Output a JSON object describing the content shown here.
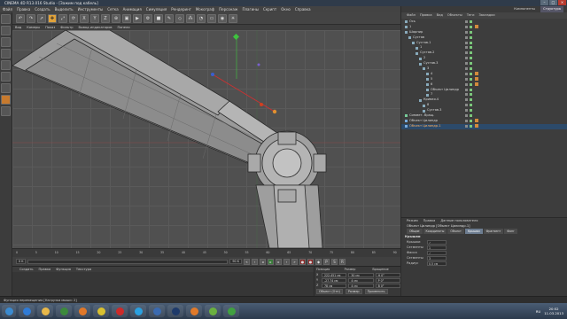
{
  "window": {
    "title": "CINEMA 4D R13.016 Studio - [Зажим под кабель]"
  },
  "menubar": [
    "Файл",
    "Правка",
    "Создать",
    "Выделить",
    "Инструменты",
    "Сетка",
    "Анимация",
    "Симуляция",
    "Рендеринг",
    "Мокограф",
    "Персонаж",
    "Плагины",
    "Скрипт",
    "Окно",
    "Справка"
  ],
  "toolbar": {
    "buttons": [
      "undo",
      "redo",
      "select",
      "move",
      "scale",
      "rotate",
      "x",
      "y",
      "z",
      "coord",
      "render-region",
      "render",
      "render-settings",
      "cube",
      "pen",
      "subdivide",
      "array",
      "deformer",
      "floor",
      "camera",
      "light"
    ]
  },
  "viewport": {
    "menu": [
      "Вид",
      "Камеры",
      "Показ",
      "Фильтр",
      "Вывод индикаторов",
      "Панели"
    ]
  },
  "timeline": {
    "ticks": [
      "0",
      "5",
      "10",
      "15",
      "20",
      "25",
      "30",
      "35",
      "40",
      "45",
      "50",
      "55",
      "60",
      "65",
      "70",
      "75",
      "80",
      "85",
      "90"
    ],
    "start_field": "0 K",
    "end_field": "90 K",
    "cur_field": "0 K"
  },
  "materials": {
    "menu": [
      "Создать",
      "Правка",
      "Функция",
      "Текстура"
    ]
  },
  "coords": {
    "headers": [
      "Позиция",
      "Размер",
      "Вращение"
    ],
    "rows": [
      {
        "axis": "X",
        "pos": "222.451 см",
        "size": "30 см",
        "rot": "H 0°"
      },
      {
        "axis": "Y",
        "pos": "-27.74 см",
        "size": "4 см",
        "rot": "P 0°"
      },
      {
        "axis": "Z",
        "pos": "78 см",
        "size": "4 см",
        "rot": "B 0°"
      }
    ],
    "mode": "Объект (Отн)",
    "size_mode": "Размер",
    "apply": "Применить"
  },
  "objects": {
    "tabs_top": [
      "Компоненты",
      "Структура"
    ],
    "menu": [
      "Файл",
      "Правка",
      "Вид",
      "Объекты",
      "Теги",
      "Закладки"
    ],
    "rows": [
      {
        "name": "Ось",
        "indent": 0,
        "icon": "null",
        "tag": false
      },
      {
        "name": "1",
        "indent": 0,
        "icon": "null",
        "tag": true
      },
      {
        "name": "Шарнир",
        "indent": 0,
        "icon": "null",
        "tag": false
      },
      {
        "name": "Сустав",
        "indent": 1,
        "icon": "null",
        "tag": false
      },
      {
        "name": "Сустав.1",
        "indent": 2,
        "icon": "null",
        "tag": false
      },
      {
        "name": "1",
        "indent": 3,
        "icon": "null",
        "tag": false
      },
      {
        "name": "Сустав.2",
        "indent": 3,
        "icon": "null",
        "tag": false
      },
      {
        "name": "2",
        "indent": 4,
        "icon": "null",
        "tag": false
      },
      {
        "name": "Сустав.3",
        "indent": 4,
        "icon": "null",
        "tag": false
      },
      {
        "name": "3",
        "indent": 5,
        "icon": "null",
        "tag": false
      },
      {
        "name": "4",
        "indent": 6,
        "icon": "null",
        "tag": true
      },
      {
        "name": "5",
        "indent": 6,
        "icon": "null",
        "tag": true
      },
      {
        "name": "6",
        "indent": 6,
        "icon": "null",
        "tag": true
      },
      {
        "name": "Объект Цилиндр",
        "indent": 6,
        "icon": "null",
        "tag": false
      },
      {
        "name": "7",
        "indent": 6,
        "icon": "null",
        "tag": false
      },
      {
        "name": "Кривая.4",
        "indent": 4,
        "icon": "null",
        "tag": false
      },
      {
        "name": "8",
        "indent": 5,
        "icon": "null",
        "tag": false
      },
      {
        "name": "Сустав.3",
        "indent": 5,
        "icon": "null",
        "tag": false
      },
      {
        "name": "Симмет. Вращ.",
        "indent": 0,
        "icon": "green",
        "tag": false
      },
      {
        "name": "Объект Цилиндр",
        "indent": 0,
        "icon": "blue",
        "tag": true
      },
      {
        "name": "Объект Цилиндр.1",
        "indent": 0,
        "icon": "blue",
        "tag": true,
        "highlight": true
      }
    ]
  },
  "attributes": {
    "menu": [
      "Режим",
      "Правка",
      "Данные пользователя"
    ],
    "title": "Объект Цилиндр [Объект Цилиндр.1]",
    "tabs": [
      "Общие",
      "Координаты",
      "Объект",
      "Крышки",
      "Фрагмент",
      "Фонг"
    ],
    "active_tab": "Крышки",
    "section": "Крышки",
    "fields": [
      {
        "label": "Крышки",
        "value": "✓"
      },
      {
        "label": "Сегменты",
        "value": "1"
      },
      {
        "label": "Фаска",
        "value": "✓"
      },
      {
        "label": "Сегменты",
        "value": "3"
      },
      {
        "label": "Радиус",
        "value": "0.5 см"
      }
    ]
  },
  "statusbar": {
    "text": "Функция перемещения [Нагрузка мыши: 2]"
  },
  "taskbar": {
    "apps": [
      "start",
      "ie",
      "explorer",
      "media",
      "firefox",
      "chrome",
      "opera",
      "skype",
      "cinema4d",
      "photoshop",
      "aimp",
      "utorrent",
      "qip"
    ],
    "lang": "RU",
    "time": "20:52",
    "date": "11.03.2013"
  },
  "colors": {
    "accent": "#e0a23a",
    "selection": "#2c4a6a",
    "taskbar": "#3b4d63"
  }
}
